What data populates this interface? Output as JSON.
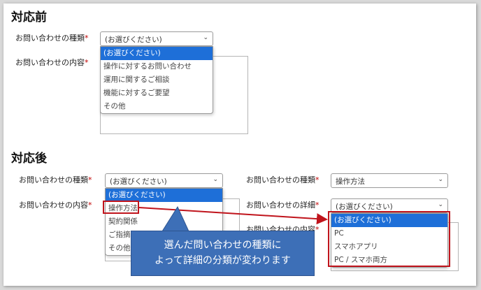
{
  "before": {
    "title": "対応前",
    "type_label": "お問い合わせの種類",
    "content_label": "お問い合わせの内容",
    "required_mark": "*",
    "type_select_value": "(お選びください)",
    "type_options": [
      "(お選びください)",
      "操作に対するお問い合わせ",
      "運用に関するご相談",
      "機能に対するご要望",
      "その他"
    ]
  },
  "after": {
    "title": "対応後",
    "left": {
      "type_label": "お問い合わせの種類",
      "content_label": "お問い合わせの内容",
      "required_mark": "*",
      "type_select_value": "(お選びください)",
      "type_options": [
        "(お選びください)",
        "操作方法",
        "契約関係",
        "ご指摘",
        "その他"
      ]
    },
    "right": {
      "type_label": "お問い合わせの種類",
      "detail_label": "お問い合わせの詳細",
      "content_label": "お問い合わせの内容",
      "required_mark": "*",
      "type_select_value": "操作方法",
      "detail_select_value": "(お選びください)",
      "detail_options": [
        "(お選びください)",
        "PC",
        "スマホアプリ",
        "PC / スマホ両方"
      ]
    },
    "callout": {
      "line1": "選んだ問い合わせの種類に",
      "line2": "よって詳細の分類が変わります"
    }
  },
  "colors": {
    "selected_option": "#1e6fd8",
    "highlight": "#c0141c",
    "callout_bg": "#3d6fb7",
    "required": "#c00000"
  },
  "icons": {
    "select_chevron": "chevron-down-icon"
  }
}
